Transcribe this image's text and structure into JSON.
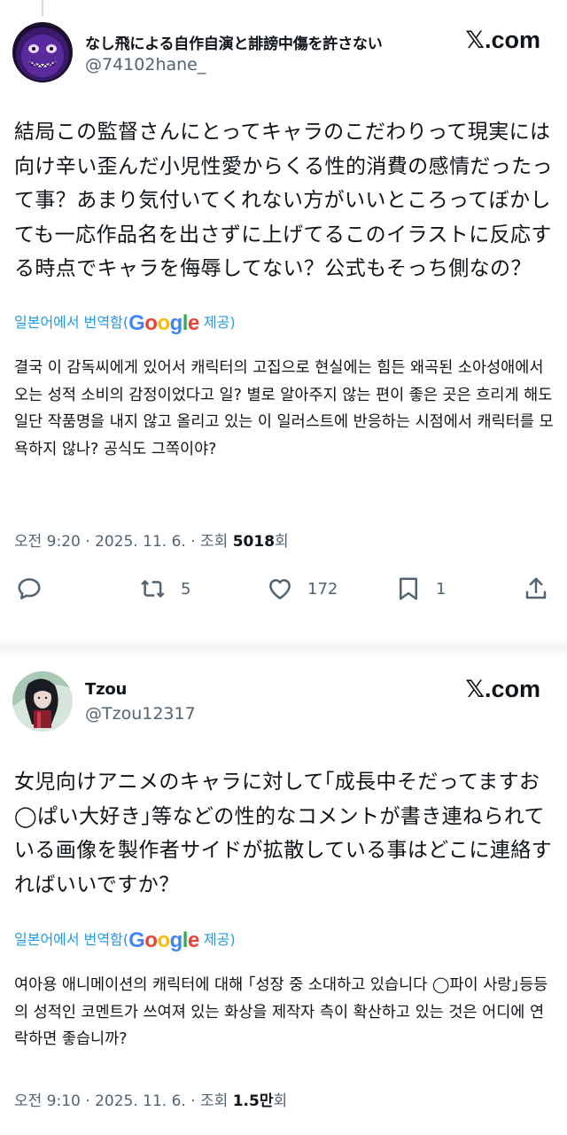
{
  "tweets": [
    {
      "author": {
        "name": "なし飛による自作自演と誹謗中傷を許さない",
        "handle": "@74102hane_"
      },
      "source_logo": "X.com",
      "text_jp": "結局この監督さんにとってキャラのこだわりって現実には向け辛い歪んだ小児性愛からくる性的消費の感情だったって事？あまり気付いてくれない方がいいところってぼかしても一応作品名を出さずに上げてるこのイラストに反応する時点でキャラを侮辱してない？公式もそっち側なの？",
      "translate_prefix": "일본어에서 번역함(",
      "translate_provider": "Google",
      "translate_suffix": " 제공)",
      "text_ko": "결국 이 감독씨에게 있어서 캐릭터의 고집으로 현실에는 힘든 왜곡된 소아성애에서 오는 성적 소비의 감정이었다고 일? 별로 알아주지 않는 편이 좋은 곳은 흐리게 해도 일단 작품명을 내지 않고 올리고 있는 이 일러스트에 반응하는 시점에서 캐릭터를 모욕하지 않나? 공식도 그쪽이야?",
      "time": "오전 9:20",
      "date": "2025. 11. 6.",
      "views_label": "조회 ",
      "views_value": "5018",
      "views_suffix": "회",
      "actions": {
        "reply_icon": "reply-icon",
        "retweet_count": "5",
        "like_count": "172",
        "bookmark_count": "1",
        "share_icon": "share-icon"
      }
    },
    {
      "author": {
        "name": "Tzou",
        "handle": "@Tzou12317"
      },
      "source_logo": "X.com",
      "text_jp": "女児向けアニメのキャラに対して｢成長中そだってますお◯ぱい大好き｣等などの性的なコメントが書き連ねられている画像を製作者サイドが拡散している事はどこに連絡すればいいですか？",
      "translate_prefix": "일본어에서 번역함(",
      "translate_provider": "Google",
      "translate_suffix": " 제공)",
      "text_ko": "여아용 애니메이션의 캐릭터에 대해 ｢성장 중 소대하고 있습니다 ◯파이 사랑｣등등의 성적인 코멘트가 쓰여져 있는 화상을 제작자 측이 확산하고 있는 것은 어디에 연락하면 좋습니까?",
      "time": "오전 9:10",
      "date": "2025. 11. 6.",
      "views_label": "조회 ",
      "views_value": "1.5만",
      "views_suffix": "회"
    }
  ],
  "colors": {
    "text": "#0f1419",
    "secondary": "#536471",
    "link": "#1d9bf0",
    "google_blue": "#4285f4",
    "google_red": "#ea4335",
    "google_yellow": "#fbbc05",
    "google_green": "#34a853"
  }
}
